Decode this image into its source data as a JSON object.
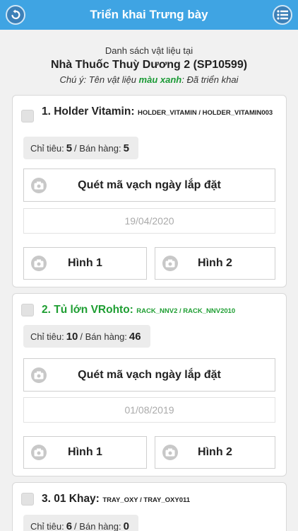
{
  "header": {
    "title": "Triển khai Trưng bày",
    "back_icon": "back-arrow-icon",
    "menu_icon": "list-menu-icon"
  },
  "intro": {
    "line1": "Danh sách vật liệu tại",
    "store": "Nhà Thuốc Thuỳ Dương 2 (SP10599)",
    "note_prefix": "Chú ý: Tên vật liệu ",
    "note_green": "màu xanh",
    "note_suffix": ": Đã triển khai"
  },
  "labels": {
    "target": "Chỉ tiêu:",
    "sales": "Bán hàng:",
    "scan": "Quét mã vạch ngày lắp đặt",
    "photo1": "Hình 1",
    "photo2": "Hình 2"
  },
  "items": [
    {
      "name": "1. Holder Vitamin:",
      "codes": "HOLDER_VITAMIN / HOLDER_VITAMIN003",
      "deployed": false,
      "target": "5",
      "sales": "5",
      "date": "19/04/2020"
    },
    {
      "name": "2. Tủ lớn VRohto:",
      "codes": "RACK_NNV2 / RACK_NNV2010",
      "deployed": true,
      "target": "10",
      "sales": "46",
      "date": "01/08/2019"
    },
    {
      "name": "3. 01 Khay:",
      "codes": "TRAY_OXY / TRAY_OXY011",
      "deployed": false,
      "target": "6",
      "sales": "0"
    }
  ],
  "colors": {
    "header_bg": "#3fa4e3",
    "deployed_green": "#1e9e32"
  }
}
